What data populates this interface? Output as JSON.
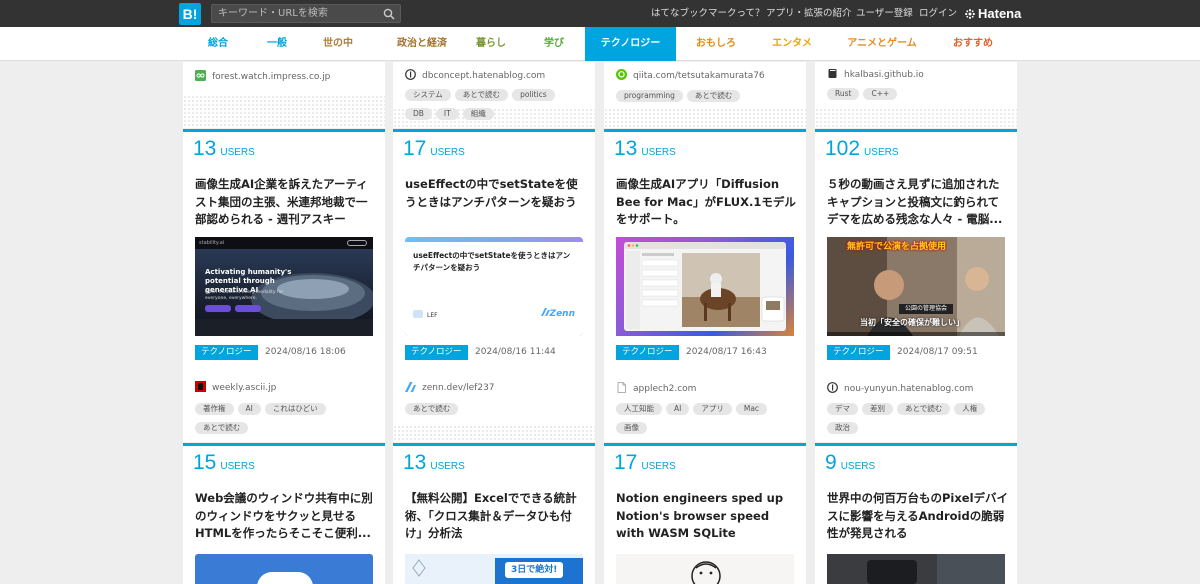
{
  "topbar": {
    "logo": "B!",
    "search_placeholder": "キーワード・URLを検索",
    "links": [
      "はてなブックマークって？",
      "アプリ・拡張の紹介",
      "ユーザー登録",
      "ログイン"
    ],
    "hatena": "Hatena"
  },
  "categories": [
    {
      "label": "総合",
      "color": "#00a4de"
    },
    {
      "label": "一般",
      "color": "#00a4de"
    },
    {
      "label": "世の中",
      "color": "#ad7f3c"
    },
    {
      "label": "政治と経済",
      "color": "#a1732e"
    },
    {
      "label": "暮らし",
      "color": "#7b9a35"
    },
    {
      "label": "学び",
      "color": "#5aa83b"
    },
    {
      "label": "テクノロジー",
      "color": "#ffffff"
    },
    {
      "label": "おもしろ",
      "color": "#e48d0d"
    },
    {
      "label": "エンタメ",
      "color": "#e8a40a"
    },
    {
      "label": "アニメとゲーム",
      "color": "#e58c26"
    },
    {
      "label": "おすすめ",
      "color": "#e3612c"
    }
  ],
  "prev_row": [
    {
      "domain": "forest.watch.impress.co.jp",
      "tags": []
    },
    {
      "domain": "dbconcept.hatenablog.com",
      "tags": [
        "システム",
        "あとで読む",
        "politics",
        "DB",
        "IT",
        "組織"
      ]
    },
    {
      "domain": "qiita.com/tetsutakamurata76",
      "tags": [
        "programming",
        "あとで読む"
      ]
    },
    {
      "domain": "hkalbasi.github.io",
      "tags": [
        "Rust",
        "C++"
      ]
    }
  ],
  "row1": [
    {
      "users": "13",
      "users_label": "USERS",
      "title": "画像生成AI企業を訴えたアーティスト集団の主張、米連邦地裁で一部認められる - 週刊アスキー",
      "category": "テクノロジー",
      "date": "2024/08/16 18:06",
      "domain": "weekly.ascii.jp",
      "tags": [
        "著作権",
        "AI",
        "これはひどい",
        "あとで読む"
      ],
      "thumb": {
        "nav": "stability.ai",
        "headline": "Activating humanity's potential through generative AI",
        "sub": "Open models in every modality for everyone, everywhere."
      }
    },
    {
      "users": "17",
      "users_label": "USERS",
      "title": "useEffectの中でsetStateを使うときはアンチパターンを疑おう",
      "category": "テクノロジー",
      "date": "2024/08/16 11:44",
      "domain": "zenn.dev/lef237",
      "tags": [
        "あとで読む"
      ],
      "thumb": {
        "text": "useEffectの中でsetStateを使うときはアンチパターンを疑おう",
        "author": "LEF",
        "brand": "Zenn"
      }
    },
    {
      "users": "13",
      "users_label": "USERS",
      "title": "画像生成AIアプリ「Diffusion Bee for Mac」がFLUX.1モデルをサポート。",
      "category": "テクノロジー",
      "date": "2024/08/17 16:43",
      "domain": "applech2.com",
      "tags": [
        "人工知能",
        "AI",
        "アプリ",
        "Mac",
        "画像"
      ]
    },
    {
      "users": "102",
      "users_label": "USERS",
      "title": "５秒の動画さえ見ずに追加されたキャプションと投稿文に釣られてデマを広める残念な人々 - 電脳...",
      "category": "テクノロジー",
      "date": "2024/08/17 09:51",
      "domain": "nou-yunyun.hatenablog.com",
      "tags": [
        "デマ",
        "差別",
        "あとで読む",
        "人権",
        "政治"
      ],
      "thumb": {
        "caption_top": "無許可で公演を占拠使用",
        "caption_mid": "公園の管理協会",
        "caption_bot": "当初「安全の確保が難しい」"
      }
    }
  ],
  "row2": [
    {
      "users": "15",
      "users_label": "USERS",
      "title": "Web会議のウィンドウ共有中に別のウィンドウをサクッと見せるHTMLを作ったらそこそこ便利..."
    },
    {
      "users": "13",
      "users_label": "USERS",
      "title": "【無料公開】Excelでできる統計術、「クロス集計＆データひも付け」分析法",
      "thumb_text": "3日で絶対!"
    },
    {
      "users": "17",
      "users_label": "USERS",
      "title": "Notion engineers sped up Notion's browser speed with WASM SQLite"
    },
    {
      "users": "9",
      "users_label": "USERS",
      "title": "世界中の何百万台ものPixelデバイスに影響を与えるAndroidの脆弱性が発見される"
    }
  ]
}
